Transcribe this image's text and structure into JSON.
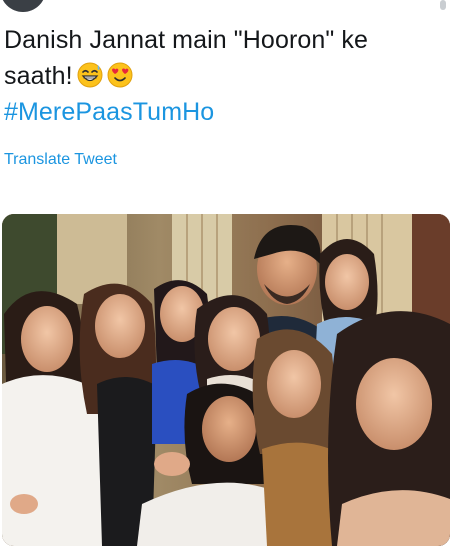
{
  "tweet": {
    "text_line1": "Danish Jannat main \"Hooron\" ke",
    "text_line2": "saath!",
    "emojis": [
      "grinning-sweat-emoji",
      "heart-eyes-emoji"
    ],
    "hashtag": "#MerePaasTumHo",
    "translate_label": "Translate Tweet"
  },
  "media": {
    "type": "photo",
    "description_icon": "group-selfie-photo"
  },
  "colors": {
    "text": "#14171a",
    "link": "#1b95e0",
    "background": "#ffffff"
  }
}
